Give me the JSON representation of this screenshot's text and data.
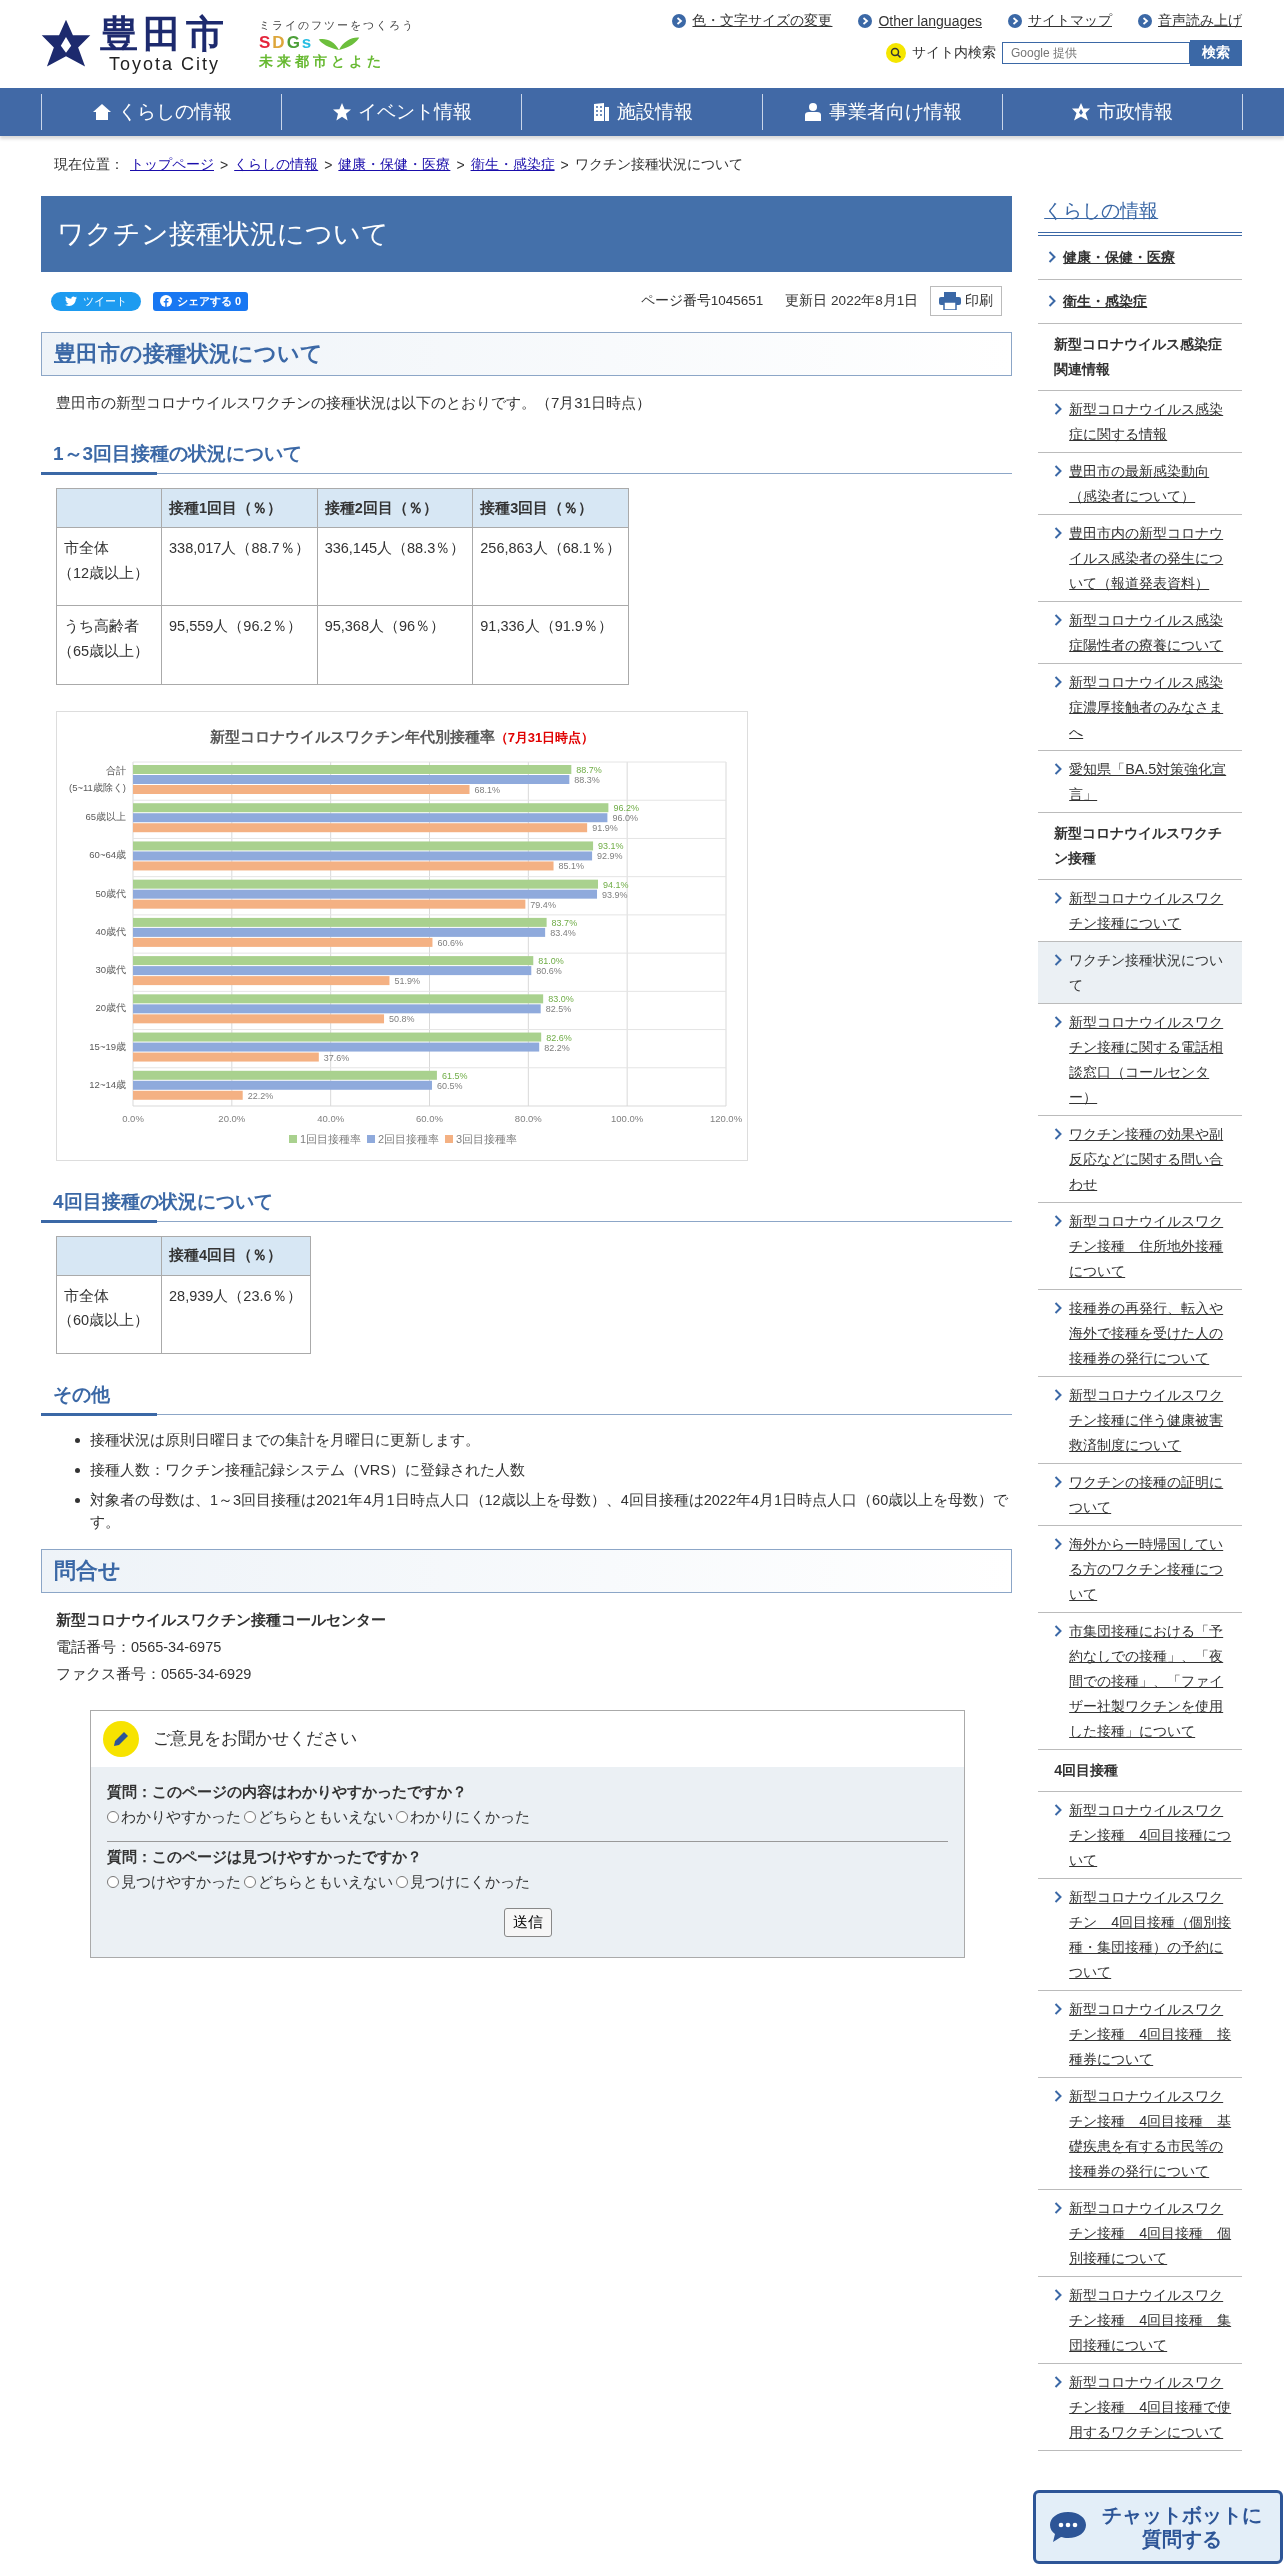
{
  "header": {
    "logo": {
      "name": "豊田市",
      "romaji": "Toyota City",
      "slogan": "ミライのフツーをつくろう",
      "sdgs": "SDGs",
      "tagline": "未来都市とよた"
    },
    "utility_links": [
      "色・文字サイズの変更",
      "Other languages",
      "サイトマップ",
      "音声読み上げ"
    ],
    "search": {
      "label": "サイト内検索",
      "placeholder": "Google 提供",
      "button": "検索"
    }
  },
  "nav": [
    {
      "label": "くらしの情報",
      "kind": "house"
    },
    {
      "label": "イベント情報",
      "kind": "star"
    },
    {
      "label": "施設情報",
      "kind": "building"
    },
    {
      "label": "事業者向け情報",
      "kind": "person"
    },
    {
      "label": "市政情報",
      "kind": "emblem"
    }
  ],
  "breadcrumb": {
    "label": "現在位置：",
    "separator": ">",
    "links": [
      "トップページ",
      "くらしの情報",
      "健康・保健・医療",
      "衛生・感染症"
    ],
    "current": "ワクチン接種状況について"
  },
  "page_title": "ワクチン接種状況について",
  "share": {
    "tweet": "ツイート",
    "facebook": "シェアする 0"
  },
  "meta": {
    "page_number": "ページ番号1045651",
    "updated": "更新日 2022年8月1日",
    "print": "印刷"
  },
  "status_section": {
    "heading": "豊田市の接種状況について",
    "intro": "豊田市の新型コロナウイルスワクチンの接種状況は以下のとおりです。（7月31日時点）"
  },
  "doses_1_3": {
    "heading": "1～3回目接種の状況について",
    "table": {
      "columns": [
        "接種1回目（％）",
        "接種2回目（％）",
        "接種3回目（％）"
      ],
      "rows": [
        {
          "label": [
            "市全体",
            "（12歳以上）"
          ],
          "cells": [
            "338,017人（88.7％）",
            "336,145人（88.3％）",
            "256,863人（68.1％）"
          ]
        },
        {
          "label": [
            "うち高齢者",
            "（65歳以上）"
          ],
          "cells": [
            "95,559人（96.2％）",
            "95,368人（96％）",
            "91,336人（91.9％）"
          ]
        }
      ]
    }
  },
  "chart": {
    "title_note": "（7月31日時点）",
    "chart_data": {
      "type": "bar",
      "orientation": "horizontal",
      "title": "新型コロナウイルスワクチン年代別接種率",
      "categories": [
        "合計\n(5~11歳除く)",
        "65歳以上",
        "60~64歳",
        "50歳代",
        "40歳代",
        "30歳代",
        "20歳代",
        "15~19歳",
        "12~14歳"
      ],
      "series": [
        {
          "name": "1回目接種率",
          "color": "#a9d18e",
          "values": [
            88.7,
            96.2,
            93.1,
            94.1,
            83.7,
            81.0,
            83.0,
            82.6,
            61.5
          ]
        },
        {
          "name": "2回目接種率",
          "color": "#8faadc",
          "values": [
            88.3,
            96.0,
            92.9,
            93.9,
            83.4,
            80.6,
            82.5,
            82.2,
            60.5
          ]
        },
        {
          "name": "3回目接種率",
          "color": "#f4b183",
          "values": [
            68.1,
            91.9,
            85.1,
            79.4,
            60.6,
            51.9,
            50.8,
            37.6,
            22.2
          ]
        }
      ],
      "xlim": [
        0,
        120
      ],
      "xticks": [
        {
          "value": 0,
          "label": "0.0%"
        },
        {
          "value": 20,
          "label": "20.0%"
        },
        {
          "value": 40,
          "label": "40.0%"
        },
        {
          "value": 60,
          "label": "60.0%"
        },
        {
          "value": 80,
          "label": "80.0%"
        },
        {
          "value": 100,
          "label": "100.0%"
        },
        {
          "value": 120,
          "label": "120.0%"
        }
      ],
      "grid": true,
      "legend": "bottom",
      "value_labels": [
        [
          "88.7%",
          "96.2%",
          "93.1%",
          "94.1%",
          "83.7%",
          "81.0%",
          "83.0%",
          "82.6%",
          "61.5%"
        ],
        [
          "88.3%",
          "96.0%",
          "92.9%",
          "93.9%",
          "83.4%",
          "80.6%",
          "82.5%",
          "82.2%",
          "60.5%"
        ],
        [
          "68.1%",
          "91.9%",
          "85.1%",
          "79.4%",
          "60.6%",
          "51.9%",
          "50.8%",
          "37.6%",
          "22.2%"
        ]
      ]
    }
  },
  "dose_4": {
    "heading": "4回目接種の状況について",
    "table": {
      "columns": [
        "接種4回目（％）"
      ],
      "rows": [
        {
          "label": [
            "市全体",
            "（60歳以上）"
          ],
          "cells": [
            "28,939人（23.6％）"
          ]
        }
      ]
    }
  },
  "other": {
    "heading": "その他",
    "bullets": [
      "接種状況は原則日曜日までの集計を月曜日に更新します。",
      "接種人数：ワクチン接種記録システム（VRS）に登録された人数",
      "対象者の母数は、1～3回目接種は2021年4月1日時点人口（12歳以上を母数）、4回目接種は2022年4月1日時点人口（60歳以上を母数）です。"
    ]
  },
  "contact": {
    "heading": "問合せ",
    "name": "新型コロナウイルスワクチン接種コールセンター",
    "phone": "電話番号：0565-34-6975",
    "fax": "ファクス番号：0565-34-6929"
  },
  "feedback": {
    "title": "ご意見をお聞かせください",
    "questions": [
      {
        "label": "質問：このページの内容はわかりやすかったですか？",
        "options": [
          {
            "label": "わかりやすかった",
            "checked": false
          },
          {
            "label": "どちらともいえない",
            "checked": false
          },
          {
            "label": "わかりにくかった",
            "checked": false
          }
        ]
      },
      {
        "label": "質問：このページは見つけやすかったですか？",
        "options": [
          {
            "label": "見つけやすかった",
            "checked": false
          },
          {
            "label": "どちらともいえない",
            "checked": false
          },
          {
            "label": "見つけにくかった",
            "checked": false
          }
        ]
      }
    ],
    "submit": "送信"
  },
  "sidebar": {
    "title": "くらしの情報",
    "items": [
      {
        "kind": "category",
        "label": "健康・保健・医療"
      },
      {
        "kind": "category",
        "label": "衛生・感染症"
      },
      {
        "kind": "heading",
        "label": "新型コロナウイルス感染症関連情報"
      },
      {
        "kind": "link",
        "label": "新型コロナウイルス感染症に関する情報",
        "selected": false
      },
      {
        "kind": "link",
        "label": "豊田市の最新感染動向（感染者について）",
        "selected": false
      },
      {
        "kind": "link",
        "label": "豊田市内の新型コロナウイルス感染者の発生について（報道発表資料）",
        "selected": false
      },
      {
        "kind": "link",
        "label": "新型コロナウイルス感染症陽性者の療養について",
        "selected": false
      },
      {
        "kind": "link",
        "label": "新型コロナウイルス感染症濃厚接触者のみなさまへ",
        "selected": false
      },
      {
        "kind": "link",
        "label": "愛知県「BA.5対策強化宣言」",
        "selected": false
      },
      {
        "kind": "heading",
        "label": "新型コロナウイルスワクチン接種"
      },
      {
        "kind": "link",
        "label": "新型コロナウイルスワクチン接種について",
        "selected": false
      },
      {
        "kind": "link",
        "label": "ワクチン接種状況について",
        "selected": true
      },
      {
        "kind": "link",
        "label": "新型コロナウイルスワクチン接種に関する電話相談窓口（コールセンター）",
        "selected": false
      },
      {
        "kind": "link",
        "label": "ワクチン接種の効果や副反応などに関する問い合わせ",
        "selected": false
      },
      {
        "kind": "link",
        "label": "新型コロナウイルスワクチン接種　住所地外接種について",
        "selected": false
      },
      {
        "kind": "link",
        "label": "接種券の再発行、転入や海外で接種を受けた人の接種券の発行について",
        "selected": false
      },
      {
        "kind": "link",
        "label": "新型コロナウイルスワクチン接種に伴う健康被害救済制度について",
        "selected": false
      },
      {
        "kind": "link",
        "label": "ワクチンの接種の証明について",
        "selected": false
      },
      {
        "kind": "link",
        "label": "海外から一時帰国している方のワクチン接種について",
        "selected": false
      },
      {
        "kind": "link",
        "label": "市集団接種における「予約なしでの接種」、「夜間での接種」、「ファイザー社製ワクチンを使用した接種」について",
        "selected": false
      },
      {
        "kind": "heading",
        "label": "4回目接種"
      },
      {
        "kind": "link",
        "label": "新型コロナウイルスワクチン接種　4回目接種について",
        "selected": false
      },
      {
        "kind": "link",
        "label": "新型コロナウイルスワクチン　4回目接種（個別接種・集団接種）の予約について",
        "selected": false
      },
      {
        "kind": "link",
        "label": "新型コロナウイルスワクチン接種　4回目接種　接種券について",
        "selected": false
      },
      {
        "kind": "link",
        "label": "新型コロナウイルスワクチン接種　4回目接種　基礎疾患を有する市民等の接種券の発行について",
        "selected": false
      },
      {
        "kind": "link",
        "label": "新型コロナウイルスワクチン接種　4回目接種　個別接種について",
        "selected": false
      },
      {
        "kind": "link",
        "label": "新型コロナウイルスワクチン接種　4回目接種　集団接種について",
        "selected": false
      },
      {
        "kind": "link",
        "label": "新型コロナウイルスワクチン接種　4回目接種で使用するワクチンについて",
        "selected": false
      }
    ]
  },
  "chatbot": {
    "label": [
      "チャットボットに",
      "質問する"
    ]
  }
}
